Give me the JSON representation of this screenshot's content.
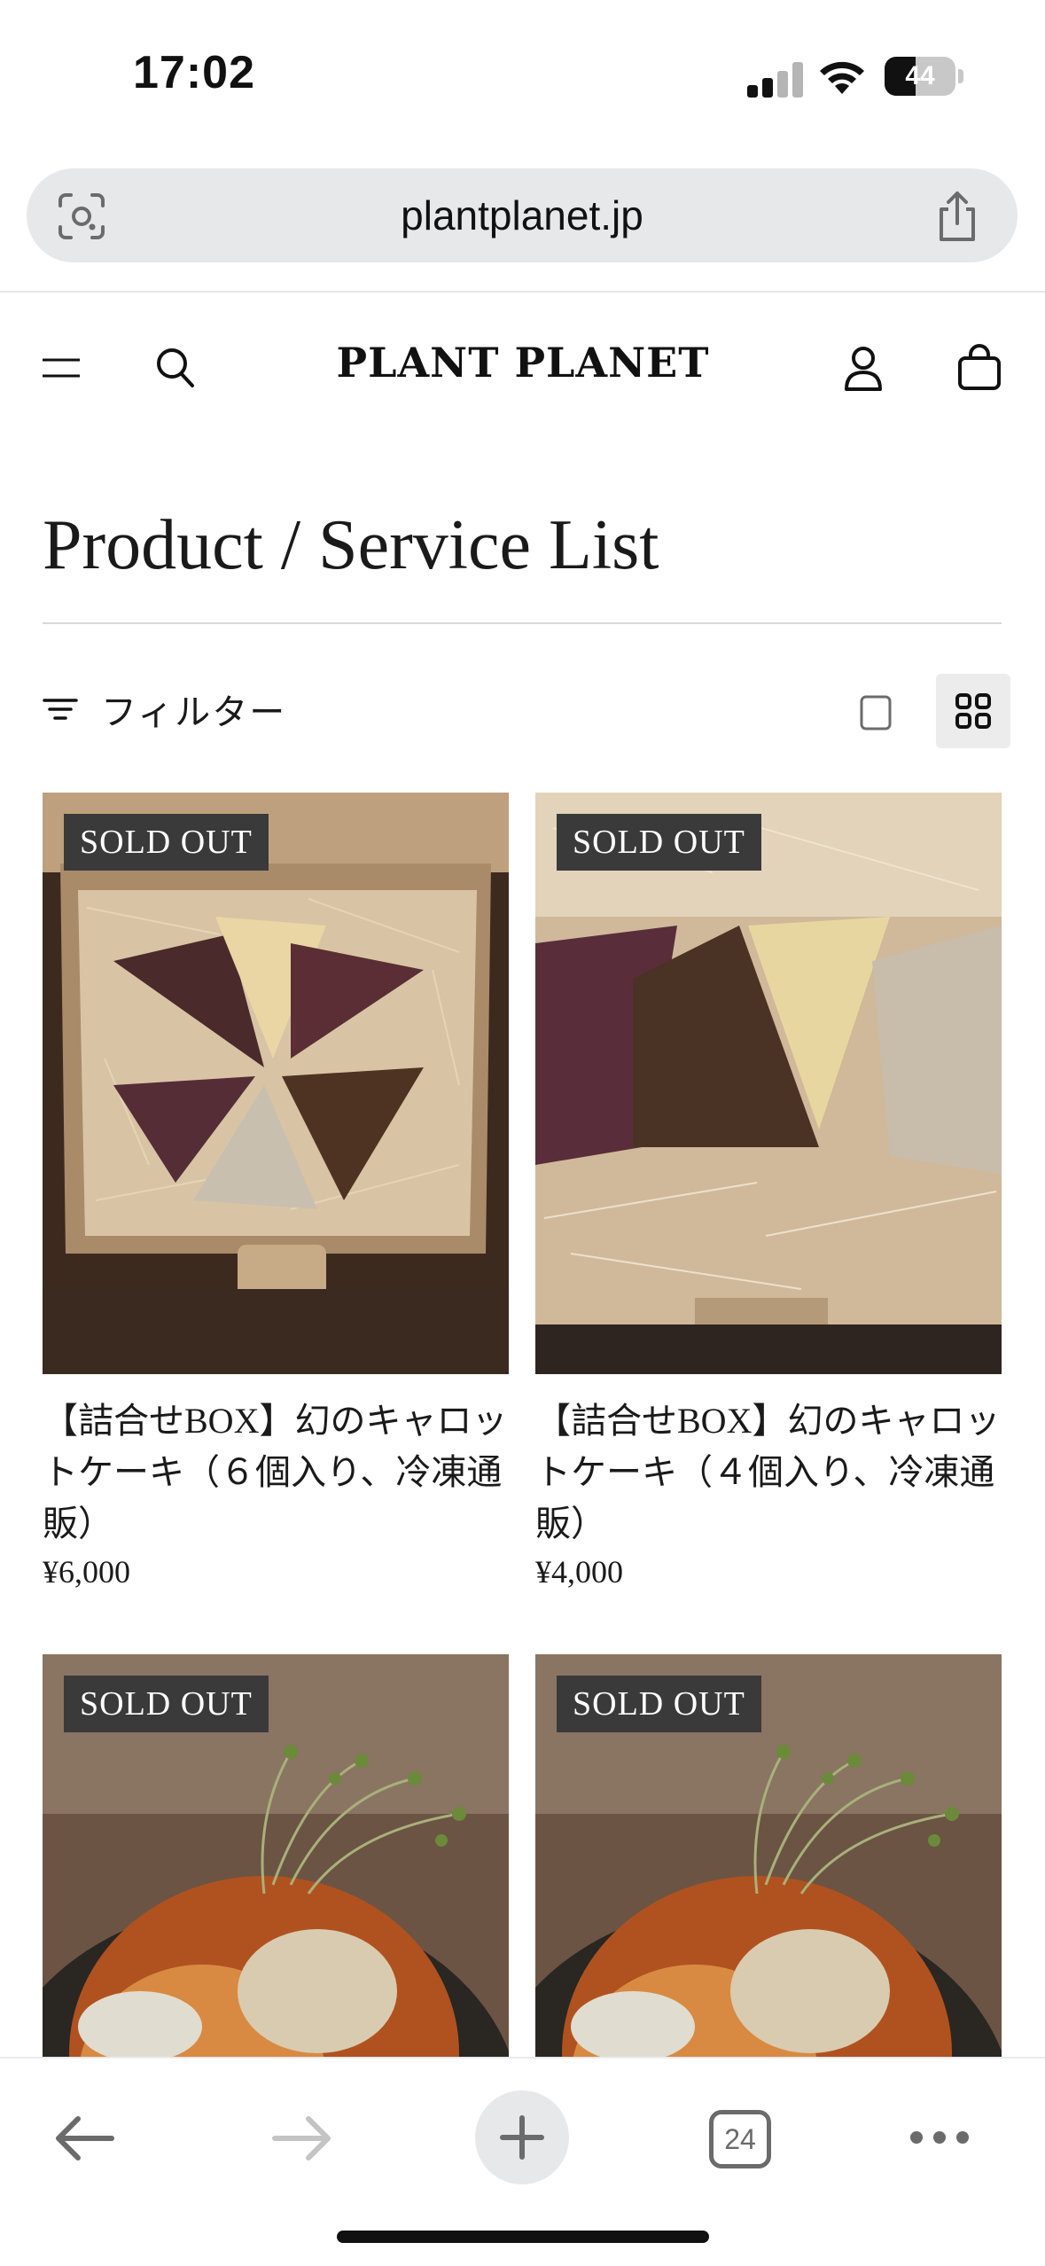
{
  "status_bar": {
    "time": "17:02",
    "battery_level": "44",
    "battery_fraction": 0.44
  },
  "browser": {
    "url": "plantplanet.jp",
    "tab_count": "24"
  },
  "site": {
    "logo": "PLANT PLANET"
  },
  "page": {
    "title": "Product / Service List",
    "filter_label": "フィルター"
  },
  "products": [
    {
      "badge": "SOLD OUT",
      "name": "【詰合せBOX】幻のキャロットケーキ（６個入り、冷凍通販）",
      "price": "¥6,000",
      "image": "carrot-cake-box-6"
    },
    {
      "badge": "SOLD OUT",
      "name": "【詰合せBOX】幻のキャロットケーキ（４個入り、冷凍通販）",
      "price": "¥4,000",
      "image": "carrot-cake-box-4"
    },
    {
      "badge": "SOLD OUT",
      "image": "plated-dish-sprouts"
    },
    {
      "badge": "SOLD OUT",
      "image": "plated-dish-sprouts"
    }
  ],
  "colors": {
    "badge_bg": "#3a3a3a",
    "address_bar_bg": "#e6e8ea",
    "text": "#1a1a1a"
  }
}
